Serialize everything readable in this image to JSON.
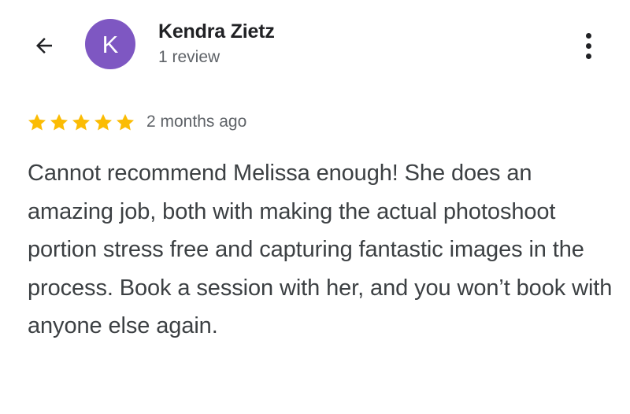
{
  "header": {
    "back_icon": "arrow-left-icon",
    "avatar_letter": "K",
    "avatar_color": "#7e57c2",
    "reviewer_name": "Kendra Zietz",
    "review_count": "1 review",
    "more_icon": "more-vert-icon"
  },
  "review": {
    "rating": 5,
    "max_rating": 5,
    "star_color": "#fbbc04",
    "date": "2 months ago",
    "text": "Cannot recommend Melissa enough! She does an amazing job, both with making the actual photoshoot portion stress free and capturing fantastic images in the process. Book a session with her, and you won’t book with anyone else again."
  }
}
